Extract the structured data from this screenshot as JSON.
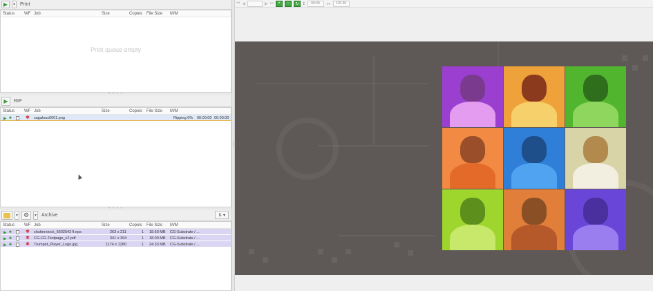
{
  "print": {
    "title": "Print",
    "columns": [
      "Status",
      "WF",
      "Job",
      "Size",
      "Copies",
      "File Size",
      "M/M"
    ],
    "empty_text": "Print queue empty"
  },
  "rip": {
    "title": "RIP",
    "columns": [
      "Status",
      "WF",
      "Job",
      "Size",
      "Copies",
      "File Size",
      "M/M"
    ],
    "job": {
      "name": "sagalous0001.png",
      "status": "Ripping 0%",
      "time1": "00:00:00",
      "time2": "00:00:00"
    }
  },
  "archive": {
    "title": "Archive",
    "columns": [
      "Status",
      "WF",
      "Job",
      "Size",
      "Copies",
      "File Size",
      "M/M"
    ],
    "jobs": [
      {
        "name": "shutterstock_6602543 fl.eps",
        "size": "263 x 211",
        "copies": "1",
        "file_size": "18.60 MB",
        "mm": "CG-Substrate / ..."
      },
      {
        "name": "CG-CG-Testpage_v2.pdf",
        "size": "341 x 394",
        "copies": "1",
        "file_size": "18.00 MB",
        "mm": "CG-Substrate / ..."
      },
      {
        "name": "Trumpet_Player_Logo.jpg",
        "size": "1174 x 1280",
        "copies": "1",
        "file_size": "24.33 MB",
        "mm": "CG-Substrate / ..."
      }
    ]
  },
  "preview_toolbar": {
    "field1": "00:00",
    "field2": "115.36"
  },
  "preview_tiles": [
    {
      "bg": "#9b3fd1",
      "skin": "#7a3b8f",
      "shirt": "#e39cf0"
    },
    {
      "bg": "#f0a23a",
      "skin": "#8b3a1e",
      "shirt": "#f6d06a"
    },
    {
      "bg": "#52b52e",
      "skin": "#2f6e1d",
      "shirt": "#8fd65e"
    },
    {
      "bg": "#f28a44",
      "skin": "#9a4f2a",
      "shirt": "#e46a2a"
    },
    {
      "bg": "#2f7fd8",
      "skin": "#1f4f8a",
      "shirt": "#4fa3f0"
    },
    {
      "bg": "#d8d4a8",
      "skin": "#b28a4e",
      "shirt": "#f2eee0"
    },
    {
      "bg": "#9ed62e",
      "skin": "#5d8f1c",
      "shirt": "#c7e86a"
    },
    {
      "bg": "#e07e3a",
      "skin": "#8a4f24",
      "shirt": "#b5592a"
    },
    {
      "bg": "#6a46d8",
      "skin": "#4a2f9e",
      "shirt": "#9a7ef0"
    }
  ]
}
